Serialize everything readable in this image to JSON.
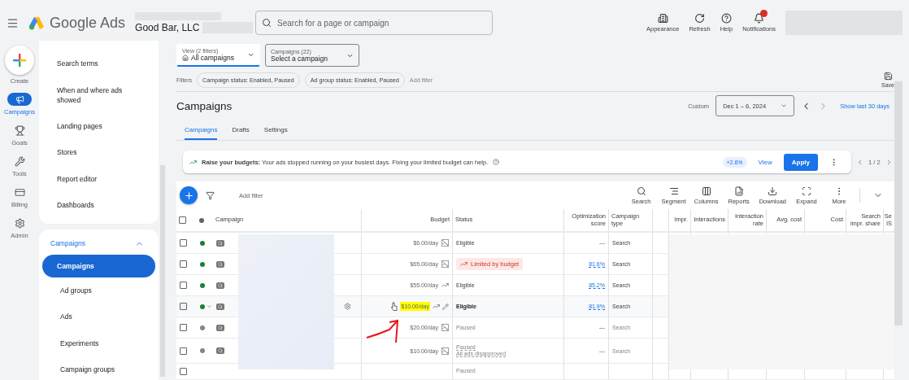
{
  "header": {
    "product": "Google Ads",
    "account": "Good Bar, LLC",
    "search": {
      "placeholder": "Search for a page or campaign"
    },
    "actions": [
      {
        "label": "Appearance",
        "kind": "appearance",
        "alert": false
      },
      {
        "label": "Refresh",
        "kind": "refresh",
        "alert": false
      },
      {
        "label": "Help",
        "kind": "help",
        "alert": false
      },
      {
        "label": "Notifications",
        "kind": "bell",
        "alert": true
      }
    ]
  },
  "rail": [
    {
      "label": "Create",
      "kind": "create",
      "selected": false
    },
    {
      "label": "Campaigns",
      "kind": "campaigns",
      "selected": true
    },
    {
      "label": "Goals",
      "kind": "goals",
      "selected": false
    },
    {
      "label": "Tools",
      "kind": "tools",
      "selected": false
    },
    {
      "label": "Billing",
      "kind": "billing",
      "selected": false
    },
    {
      "label": "Admin",
      "kind": "admin",
      "selected": false
    }
  ],
  "sidebar": {
    "items": [
      {
        "label": "Search terms",
        "selected": false
      },
      {
        "label": "When and where ads showed",
        "selected": false
      },
      {
        "label": "Landing pages",
        "selected": false
      },
      {
        "label": "Stores",
        "selected": false
      },
      {
        "label": "Report editor",
        "selected": false
      },
      {
        "label": "Dashboards",
        "selected": false
      }
    ],
    "section": {
      "title": "Campaigns",
      "expanded": true,
      "items": [
        {
          "label": "Campaigns",
          "selected": true
        },
        {
          "label": "Ad groups",
          "selected": false
        },
        {
          "label": "Ads",
          "selected": false
        },
        {
          "label": "Experiments",
          "selected": false
        },
        {
          "label": "Campaign groups",
          "selected": false
        }
      ]
    }
  },
  "selectors": [
    {
      "caption": "View (2 filters)",
      "value": "All campaigns",
      "kind": "view"
    },
    {
      "caption": "Campaigns (22)",
      "value": "Select a campaign",
      "kind": "plain"
    }
  ],
  "filters": {
    "label": "Filters",
    "chips": [
      "Campaign status: Enabled, Paused",
      "Ad group status: Enabled, Paused"
    ],
    "add": "Add filter",
    "save": "Save"
  },
  "title": "Campaigns",
  "date": {
    "label": "Custom",
    "range": "Dec 1 – 6, 2024",
    "link": "Show last 30 days"
  },
  "tabs": [
    {
      "label": "Campaigns",
      "selected": true
    },
    {
      "label": "Drafts",
      "selected": false
    },
    {
      "label": "Settings",
      "selected": false
    }
  ],
  "banner": {
    "title": "Raise your budgets:",
    "text": "Your ads stopped running on your busiest days. Fixing your limited budget can help.",
    "delta": "+2.6%",
    "view": "View",
    "apply": "Apply",
    "pager": "1 / 2"
  },
  "toolbar": {
    "add_filter": "Add filter",
    "tools": [
      {
        "label": "Search",
        "kind": "search"
      },
      {
        "label": "Segment",
        "kind": "segment"
      },
      {
        "label": "Columns",
        "kind": "columns"
      },
      {
        "label": "Reports",
        "kind": "reports"
      },
      {
        "label": "Download",
        "kind": "download"
      },
      {
        "label": "Expand",
        "kind": "expand"
      },
      {
        "label": "More",
        "kind": "more"
      }
    ]
  },
  "table": {
    "select_all": {
      "checked": false
    },
    "columns": [
      "Campaign",
      "Budget",
      "Status",
      "Optimization score",
      "Campaign type",
      "Impr.",
      "Interactions",
      "Interaction rate",
      "Avg. cost",
      "Cost",
      "Search impr. share",
      "Se IS"
    ],
    "rows": [
      {
        "checked": false,
        "color": "#188038",
        "budget": "$6.00/day",
        "chart": false,
        "highlighted": false,
        "hovered": false,
        "status": {
          "text": "Eligible",
          "kind": "plain"
        },
        "score": "—",
        "type": "Search"
      },
      {
        "checked": false,
        "color": "#188038",
        "budget": "$65.00/day",
        "chart": false,
        "highlighted": false,
        "hovered": false,
        "status": {
          "text": "Limited by budget",
          "kind": "limited"
        },
        "score": "81.6%",
        "type": "Search"
      },
      {
        "checked": false,
        "color": "#188038",
        "budget": "$55.00/day",
        "chart": true,
        "highlighted": false,
        "hovered": false,
        "status": {
          "text": "Eligible",
          "kind": "plain"
        },
        "score": "85.2%",
        "type": "Search"
      },
      {
        "checked": false,
        "color": "#188038",
        "budget": "$10.00/day",
        "chart": true,
        "highlighted": true,
        "hovered": true,
        "status": {
          "text": "Eligible",
          "kind": "plain"
        },
        "score": "81.9%",
        "type": "Search"
      },
      {
        "checked": false,
        "color": "#80868b",
        "budget": "$20.00/day",
        "chart": false,
        "highlighted": false,
        "hovered": false,
        "status": {
          "text": "Paused",
          "kind": "paused"
        },
        "score": "—",
        "type": "Search"
      },
      {
        "checked": false,
        "color": "#80868b",
        "budget": "$10.00/day",
        "chart": false,
        "highlighted": false,
        "hovered": false,
        "status": {
          "text": "Paused",
          "kind": "paused",
          "note": "All ads disapproved"
        },
        "score": "—",
        "type": "Search"
      },
      {
        "checked": false,
        "hovered": false,
        "status": {
          "text": "Paused",
          "kind": "paused"
        }
      }
    ]
  }
}
